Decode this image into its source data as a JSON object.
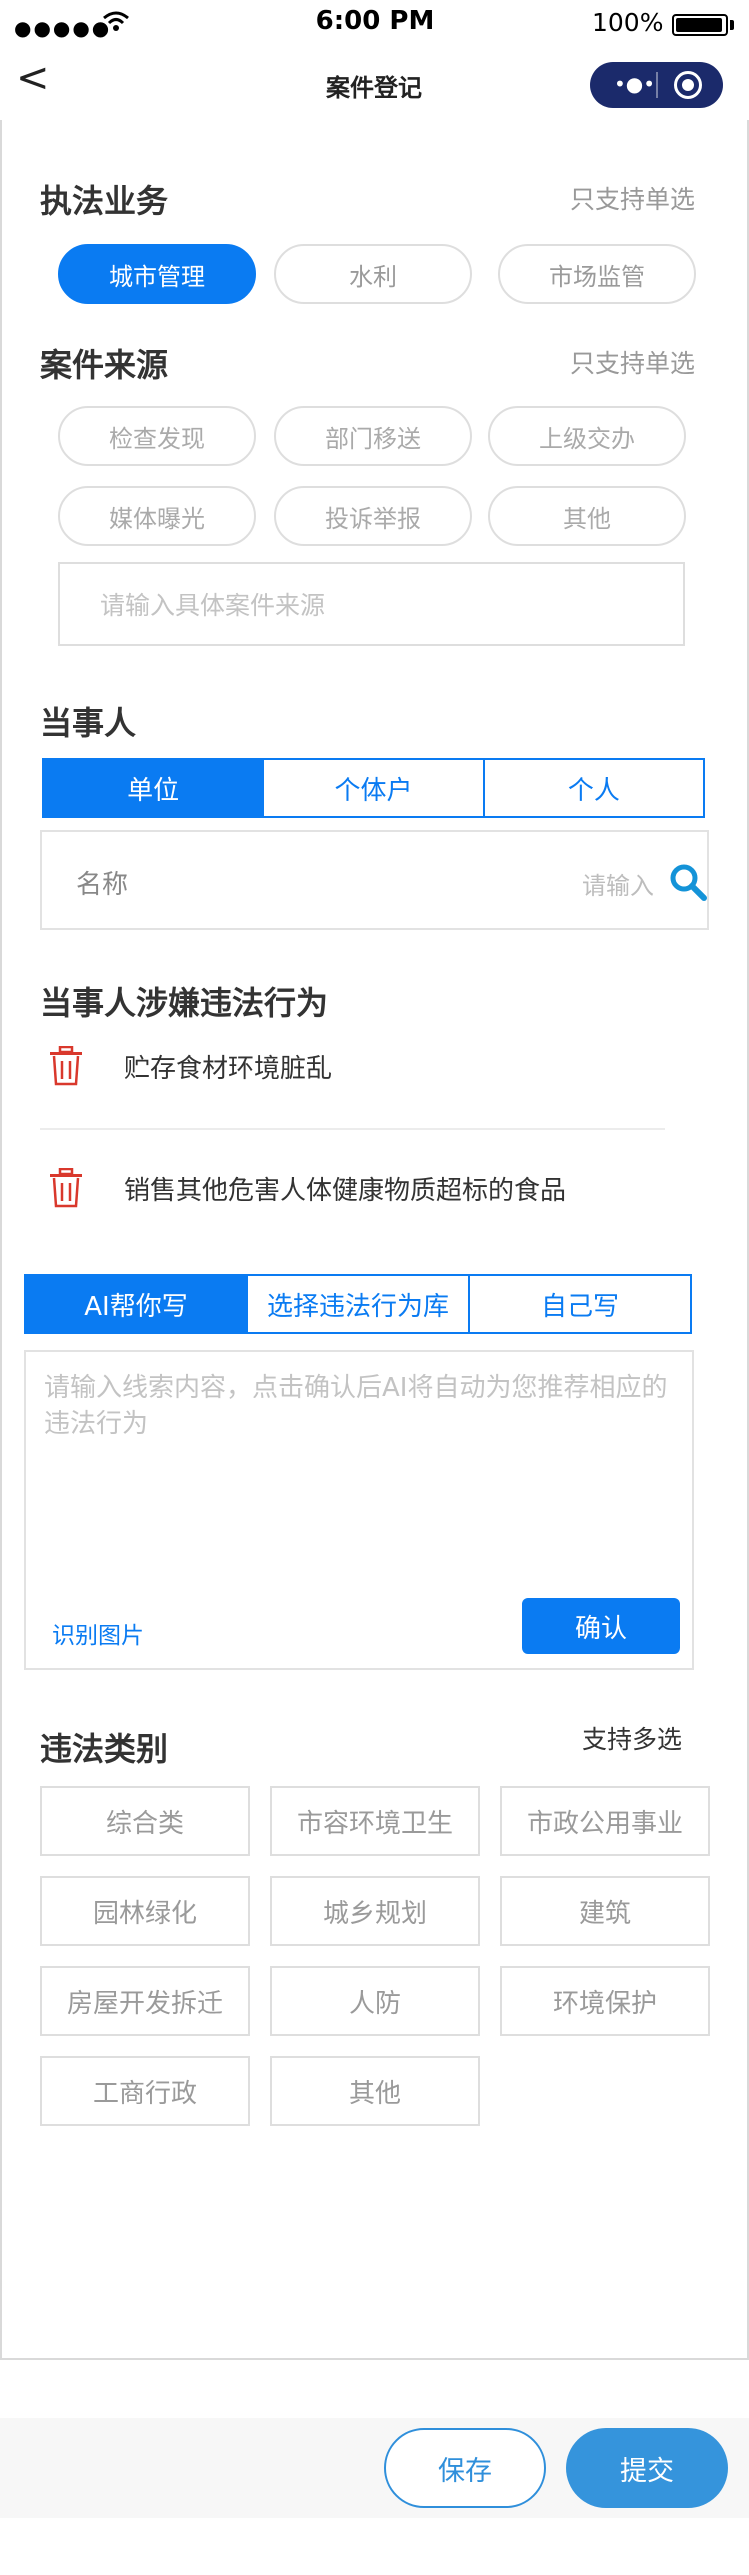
{
  "status_bar": {
    "signal": "●●●●●",
    "time": "6:00 PM",
    "battery": "100%"
  },
  "nav": {
    "back": "<",
    "title": "案件登记",
    "capsule_dots": "•●•"
  },
  "business": {
    "title": "执法业务",
    "hint": "只支持单选",
    "options": [
      "城市管理",
      "水利",
      "市场监管"
    ],
    "selected": "城市管理"
  },
  "source": {
    "title": "案件来源",
    "hint": "只支持单选",
    "options": [
      "检查发现",
      "部门移送",
      "上级交办",
      "媒体曝光",
      "投诉举报",
      "其他"
    ],
    "input_placeholder": "请输入具体案件来源"
  },
  "party": {
    "title": "当事人",
    "tabs": [
      "单位",
      "个体户",
      "个人"
    ],
    "active_tab": "单位",
    "name_label": "名称",
    "name_placeholder": "请输入"
  },
  "violations": {
    "title": "当事人涉嫌违法行为",
    "items": [
      "贮存食材环境脏乱",
      "销售其他危害人体健康物质超标的食品"
    ]
  },
  "ai": {
    "tabs": [
      "AI帮你写",
      "选择违法行为库",
      "自己写"
    ],
    "active_tab": "AI帮你写",
    "placeholder": "请输入线索内容，点击确认后AI将自动为您推荐相应的违法行为",
    "recognize_link": "识别图片",
    "confirm": "确认"
  },
  "category": {
    "title": "违法类别",
    "hint": "支持多选",
    "options": [
      "综合类",
      "市容环境卫生",
      "市政公用事业",
      "园林绿化",
      "城乡规划",
      "建筑",
      "房屋开发拆迁",
      "人防",
      "环境保护",
      "工商行政",
      "其他"
    ]
  },
  "footer": {
    "save": "保存",
    "submit": "提交"
  },
  "colors": {
    "accent": "#0a7bf2",
    "capsule": "#1b2a6b",
    "delete": "#d9382c",
    "submit": "#3594dc"
  }
}
